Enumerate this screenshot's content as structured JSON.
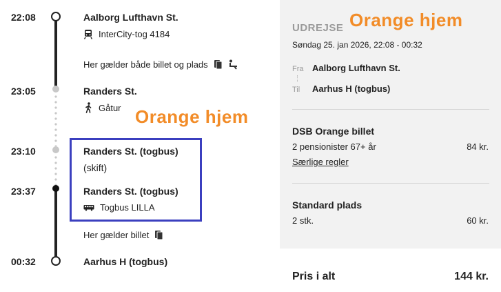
{
  "overlay": {
    "text_left": "Orange hjem",
    "text_right": "Orange hjem"
  },
  "timeline": {
    "s1": {
      "time": "22:08",
      "name": "Aalborg Lufthavn St.",
      "train": "InterCity-tog 4184"
    },
    "note1": "Her gælder både billet og plads",
    "s2": {
      "time": "23:05",
      "name": "Randers St.",
      "walk": "Gåtur"
    },
    "s3": {
      "time": "23:10",
      "name": "Randers St. (togbus)",
      "sub": "(skift)"
    },
    "s4": {
      "time": "23:37",
      "name": "Randers St. (togbus)",
      "bus": "Togbus LILLA"
    },
    "note2": "Her gælder billet",
    "s5": {
      "time": "00:32",
      "name": "Aarhus H (togbus)"
    }
  },
  "summary": {
    "heading": "UDREJSE",
    "datetime": "Søndag 25. jan 2026, 22:08 - 00:32",
    "from_label": "Fra",
    "from": "Aalborg Lufthavn St.",
    "to_label": "Til",
    "to": "Aarhus H (togbus)",
    "ticket_title": "DSB Orange billet",
    "ticket_desc": "2 pensionister 67+ år",
    "ticket_price": "84 kr.",
    "ticket_link": "Særlige regler",
    "seat_title": "Standard plads",
    "seat_desc": "2 stk.",
    "seat_price": "60 kr.",
    "total_label": "Pris i alt",
    "total_value": "144 kr."
  },
  "colors": {
    "overlay_orange": "#f28c28",
    "highlight_box": "#3b3fbf",
    "panel_bg": "#f2f2f2"
  },
  "icons": [
    "train-icon",
    "ticket-icon",
    "seat-icon",
    "walk-icon",
    "bus-icon"
  ]
}
